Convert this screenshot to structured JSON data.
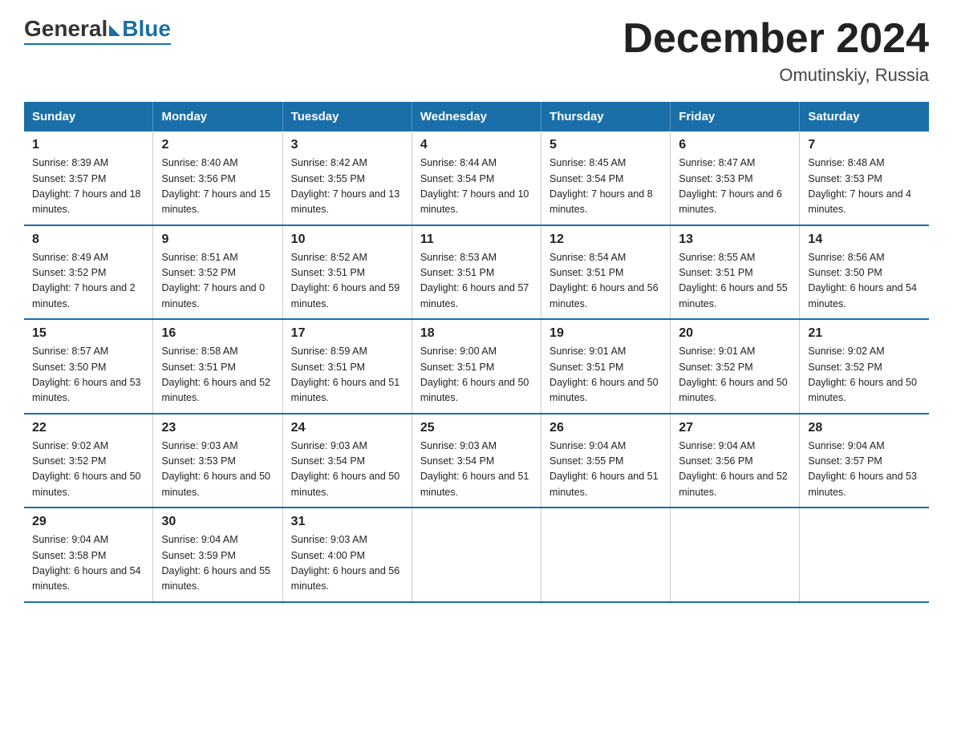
{
  "header": {
    "logo_general": "General",
    "logo_blue": "Blue",
    "title": "December 2024",
    "subtitle": "Omutinskiy, Russia"
  },
  "days_of_week": [
    "Sunday",
    "Monday",
    "Tuesday",
    "Wednesday",
    "Thursday",
    "Friday",
    "Saturday"
  ],
  "weeks": [
    [
      {
        "day": "1",
        "sunrise": "Sunrise: 8:39 AM",
        "sunset": "Sunset: 3:57 PM",
        "daylight": "Daylight: 7 hours and 18 minutes."
      },
      {
        "day": "2",
        "sunrise": "Sunrise: 8:40 AM",
        "sunset": "Sunset: 3:56 PM",
        "daylight": "Daylight: 7 hours and 15 minutes."
      },
      {
        "day": "3",
        "sunrise": "Sunrise: 8:42 AM",
        "sunset": "Sunset: 3:55 PM",
        "daylight": "Daylight: 7 hours and 13 minutes."
      },
      {
        "day": "4",
        "sunrise": "Sunrise: 8:44 AM",
        "sunset": "Sunset: 3:54 PM",
        "daylight": "Daylight: 7 hours and 10 minutes."
      },
      {
        "day": "5",
        "sunrise": "Sunrise: 8:45 AM",
        "sunset": "Sunset: 3:54 PM",
        "daylight": "Daylight: 7 hours and 8 minutes."
      },
      {
        "day": "6",
        "sunrise": "Sunrise: 8:47 AM",
        "sunset": "Sunset: 3:53 PM",
        "daylight": "Daylight: 7 hours and 6 minutes."
      },
      {
        "day": "7",
        "sunrise": "Sunrise: 8:48 AM",
        "sunset": "Sunset: 3:53 PM",
        "daylight": "Daylight: 7 hours and 4 minutes."
      }
    ],
    [
      {
        "day": "8",
        "sunrise": "Sunrise: 8:49 AM",
        "sunset": "Sunset: 3:52 PM",
        "daylight": "Daylight: 7 hours and 2 minutes."
      },
      {
        "day": "9",
        "sunrise": "Sunrise: 8:51 AM",
        "sunset": "Sunset: 3:52 PM",
        "daylight": "Daylight: 7 hours and 0 minutes."
      },
      {
        "day": "10",
        "sunrise": "Sunrise: 8:52 AM",
        "sunset": "Sunset: 3:51 PM",
        "daylight": "Daylight: 6 hours and 59 minutes."
      },
      {
        "day": "11",
        "sunrise": "Sunrise: 8:53 AM",
        "sunset": "Sunset: 3:51 PM",
        "daylight": "Daylight: 6 hours and 57 minutes."
      },
      {
        "day": "12",
        "sunrise": "Sunrise: 8:54 AM",
        "sunset": "Sunset: 3:51 PM",
        "daylight": "Daylight: 6 hours and 56 minutes."
      },
      {
        "day": "13",
        "sunrise": "Sunrise: 8:55 AM",
        "sunset": "Sunset: 3:51 PM",
        "daylight": "Daylight: 6 hours and 55 minutes."
      },
      {
        "day": "14",
        "sunrise": "Sunrise: 8:56 AM",
        "sunset": "Sunset: 3:50 PM",
        "daylight": "Daylight: 6 hours and 54 minutes."
      }
    ],
    [
      {
        "day": "15",
        "sunrise": "Sunrise: 8:57 AM",
        "sunset": "Sunset: 3:50 PM",
        "daylight": "Daylight: 6 hours and 53 minutes."
      },
      {
        "day": "16",
        "sunrise": "Sunrise: 8:58 AM",
        "sunset": "Sunset: 3:51 PM",
        "daylight": "Daylight: 6 hours and 52 minutes."
      },
      {
        "day": "17",
        "sunrise": "Sunrise: 8:59 AM",
        "sunset": "Sunset: 3:51 PM",
        "daylight": "Daylight: 6 hours and 51 minutes."
      },
      {
        "day": "18",
        "sunrise": "Sunrise: 9:00 AM",
        "sunset": "Sunset: 3:51 PM",
        "daylight": "Daylight: 6 hours and 50 minutes."
      },
      {
        "day": "19",
        "sunrise": "Sunrise: 9:01 AM",
        "sunset": "Sunset: 3:51 PM",
        "daylight": "Daylight: 6 hours and 50 minutes."
      },
      {
        "day": "20",
        "sunrise": "Sunrise: 9:01 AM",
        "sunset": "Sunset: 3:52 PM",
        "daylight": "Daylight: 6 hours and 50 minutes."
      },
      {
        "day": "21",
        "sunrise": "Sunrise: 9:02 AM",
        "sunset": "Sunset: 3:52 PM",
        "daylight": "Daylight: 6 hours and 50 minutes."
      }
    ],
    [
      {
        "day": "22",
        "sunrise": "Sunrise: 9:02 AM",
        "sunset": "Sunset: 3:52 PM",
        "daylight": "Daylight: 6 hours and 50 minutes."
      },
      {
        "day": "23",
        "sunrise": "Sunrise: 9:03 AM",
        "sunset": "Sunset: 3:53 PM",
        "daylight": "Daylight: 6 hours and 50 minutes."
      },
      {
        "day": "24",
        "sunrise": "Sunrise: 9:03 AM",
        "sunset": "Sunset: 3:54 PM",
        "daylight": "Daylight: 6 hours and 50 minutes."
      },
      {
        "day": "25",
        "sunrise": "Sunrise: 9:03 AM",
        "sunset": "Sunset: 3:54 PM",
        "daylight": "Daylight: 6 hours and 51 minutes."
      },
      {
        "day": "26",
        "sunrise": "Sunrise: 9:04 AM",
        "sunset": "Sunset: 3:55 PM",
        "daylight": "Daylight: 6 hours and 51 minutes."
      },
      {
        "day": "27",
        "sunrise": "Sunrise: 9:04 AM",
        "sunset": "Sunset: 3:56 PM",
        "daylight": "Daylight: 6 hours and 52 minutes."
      },
      {
        "day": "28",
        "sunrise": "Sunrise: 9:04 AM",
        "sunset": "Sunset: 3:57 PM",
        "daylight": "Daylight: 6 hours and 53 minutes."
      }
    ],
    [
      {
        "day": "29",
        "sunrise": "Sunrise: 9:04 AM",
        "sunset": "Sunset: 3:58 PM",
        "daylight": "Daylight: 6 hours and 54 minutes."
      },
      {
        "day": "30",
        "sunrise": "Sunrise: 9:04 AM",
        "sunset": "Sunset: 3:59 PM",
        "daylight": "Daylight: 6 hours and 55 minutes."
      },
      {
        "day": "31",
        "sunrise": "Sunrise: 9:03 AM",
        "sunset": "Sunset: 4:00 PM",
        "daylight": "Daylight: 6 hours and 56 minutes."
      },
      {
        "day": "",
        "sunrise": "",
        "sunset": "",
        "daylight": ""
      },
      {
        "day": "",
        "sunrise": "",
        "sunset": "",
        "daylight": ""
      },
      {
        "day": "",
        "sunrise": "",
        "sunset": "",
        "daylight": ""
      },
      {
        "day": "",
        "sunrise": "",
        "sunset": "",
        "daylight": ""
      }
    ]
  ]
}
